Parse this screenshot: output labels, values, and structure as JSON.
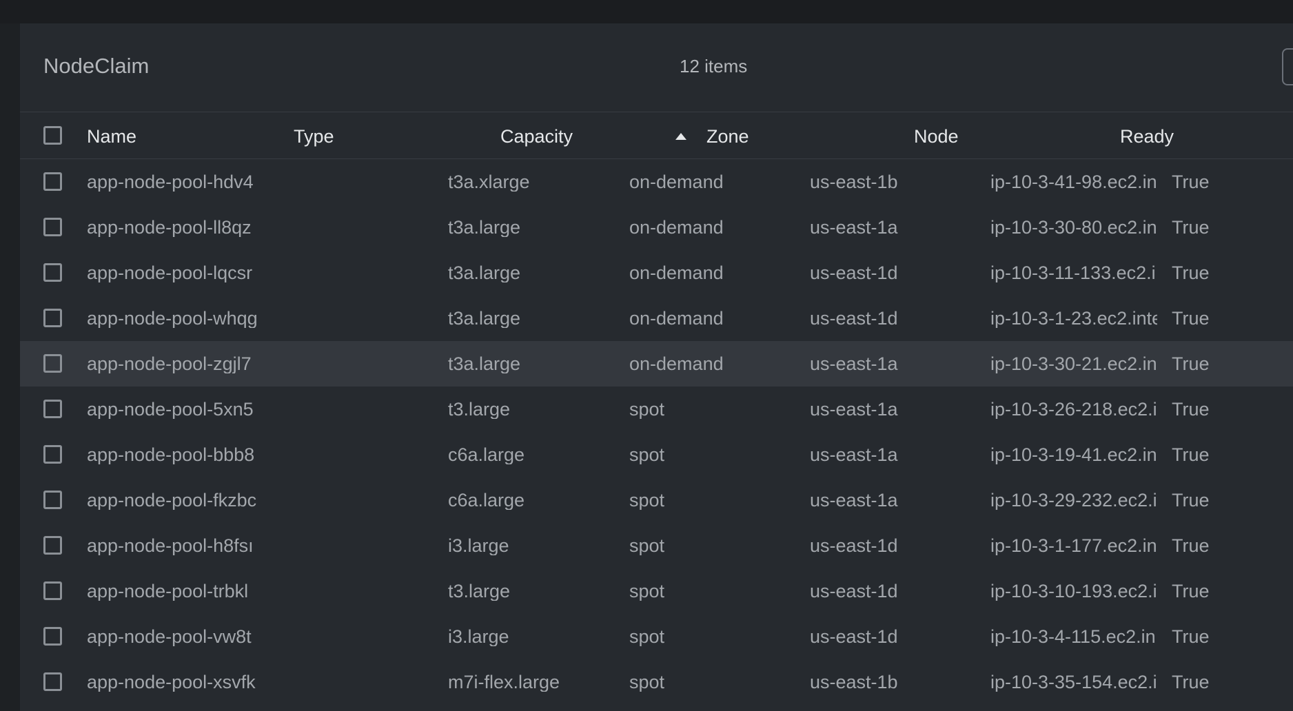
{
  "panel": {
    "title": "NodeClaim",
    "count": "12 items"
  },
  "columns": {
    "name": "Name",
    "type": "Type",
    "capacity": "Capacity",
    "zone": "Zone",
    "node": "Node",
    "ready": "Ready"
  },
  "sort": {
    "icon": "sort-ascending-icon",
    "direction": "ascending"
  },
  "hovered_row": 4,
  "rows": [
    {
      "name": "app-node-pool-hdv4",
      "type": "t3a.xlarge",
      "capacity": "on-demand",
      "zone": "us-east-1b",
      "node": "ip-10-3-41-98.ec2.in",
      "ready": "True"
    },
    {
      "name": "app-node-pool-ll8qz",
      "type": "t3a.large",
      "capacity": "on-demand",
      "zone": "us-east-1a",
      "node": "ip-10-3-30-80.ec2.in",
      "ready": "True"
    },
    {
      "name": "app-node-pool-lqcsr",
      "type": "t3a.large",
      "capacity": "on-demand",
      "zone": "us-east-1d",
      "node": "ip-10-3-11-133.ec2.i",
      "ready": "True"
    },
    {
      "name": "app-node-pool-whqg",
      "type": "t3a.large",
      "capacity": "on-demand",
      "zone": "us-east-1d",
      "node": "ip-10-3-1-23.ec2.inte",
      "ready": "True"
    },
    {
      "name": "app-node-pool-zgjl7",
      "type": "t3a.large",
      "capacity": "on-demand",
      "zone": "us-east-1a",
      "node": "ip-10-3-30-21.ec2.in",
      "ready": "True"
    },
    {
      "name": "app-node-pool-5xn5",
      "type": "t3.large",
      "capacity": "spot",
      "zone": "us-east-1a",
      "node": "ip-10-3-26-218.ec2.i",
      "ready": "True"
    },
    {
      "name": "app-node-pool-bbb8",
      "type": "c6a.large",
      "capacity": "spot",
      "zone": "us-east-1a",
      "node": "ip-10-3-19-41.ec2.in",
      "ready": "True"
    },
    {
      "name": "app-node-pool-fkzbc",
      "type": "c6a.large",
      "capacity": "spot",
      "zone": "us-east-1a",
      "node": "ip-10-3-29-232.ec2.i",
      "ready": "True"
    },
    {
      "name": "app-node-pool-h8fsı",
      "type": "i3.large",
      "capacity": "spot",
      "zone": "us-east-1d",
      "node": "ip-10-3-1-177.ec2.in",
      "ready": "True"
    },
    {
      "name": "app-node-pool-trbkl",
      "type": "t3.large",
      "capacity": "spot",
      "zone": "us-east-1d",
      "node": "ip-10-3-10-193.ec2.i",
      "ready": "True"
    },
    {
      "name": "app-node-pool-vw8t",
      "type": "i3.large",
      "capacity": "spot",
      "zone": "us-east-1d",
      "node": "ip-10-3-4-115.ec2.in",
      "ready": "True"
    },
    {
      "name": "app-node-pool-xsvfk",
      "type": "m7i-flex.large",
      "capacity": "spot",
      "zone": "us-east-1b",
      "node": "ip-10-3-35-154.ec2.i",
      "ready": "True"
    }
  ]
}
